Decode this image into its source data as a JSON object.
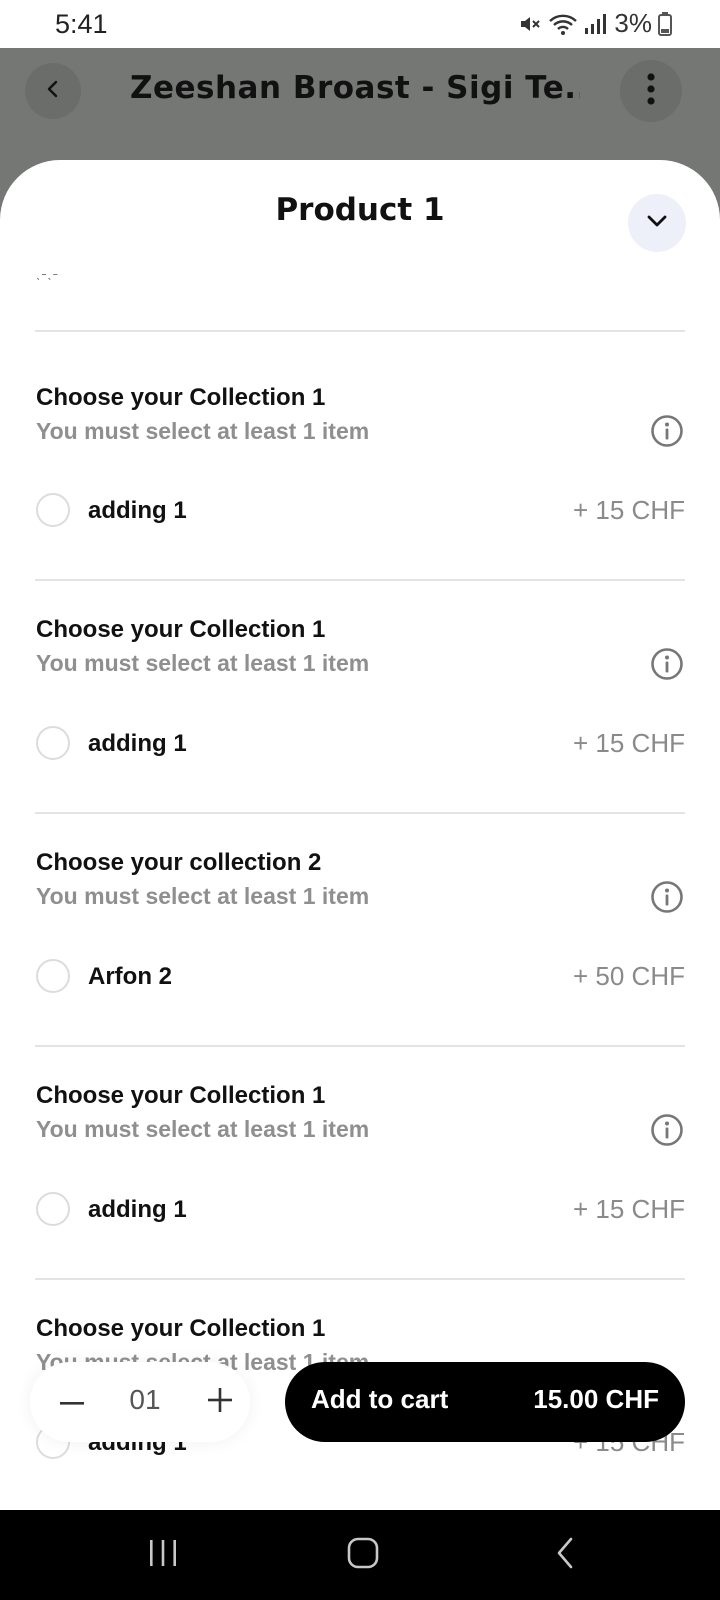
{
  "status_bar": {
    "time": "5:41",
    "battery": "3%"
  },
  "header": {
    "title": "Zeeshan Broast - Sigi Te..."
  },
  "sheet": {
    "title": "Product 1",
    "scroll_remnant": "ˎ˗ˎ˗",
    "groups": [
      {
        "title": "Choose your Collection 1",
        "subtitle": "You must select at least 1 item",
        "option": "adding 1",
        "price": "+ 15 CHF"
      },
      {
        "title": "Choose your Collection 1",
        "subtitle": "You must select at least 1 item",
        "option": "adding 1",
        "price": "+ 15 CHF"
      },
      {
        "title": "Choose your collection 2",
        "subtitle": "You must select at least 1 item",
        "option": "Arfon 2",
        "price": "+ 50 CHF"
      },
      {
        "title": "Choose your Collection 1",
        "subtitle": "You must select at least 1 item",
        "option": "adding 1",
        "price": "+ 15 CHF"
      },
      {
        "title": "Choose your Collection 1",
        "subtitle": "You must select at least 1 item",
        "option": "adding 1",
        "price": "+ 15 CHF"
      }
    ]
  },
  "footer": {
    "quantity": "01",
    "add_to_cart_label": "Add to cart",
    "total": "15.00 CHF"
  },
  "icons": [
    "back-icon",
    "more-vertical-icon",
    "chevron-down-icon",
    "info-icon",
    "minus-icon",
    "plus-icon",
    "recent-apps-icon",
    "home-icon",
    "nav-back-icon",
    "mute-icon",
    "wifi-icon",
    "signal-icon",
    "battery-icon"
  ],
  "colors": {
    "accent": "#000000",
    "header_bg": "#747774",
    "muted_text": "#8f8f8f",
    "collapse_bg": "#eef0f9"
  }
}
